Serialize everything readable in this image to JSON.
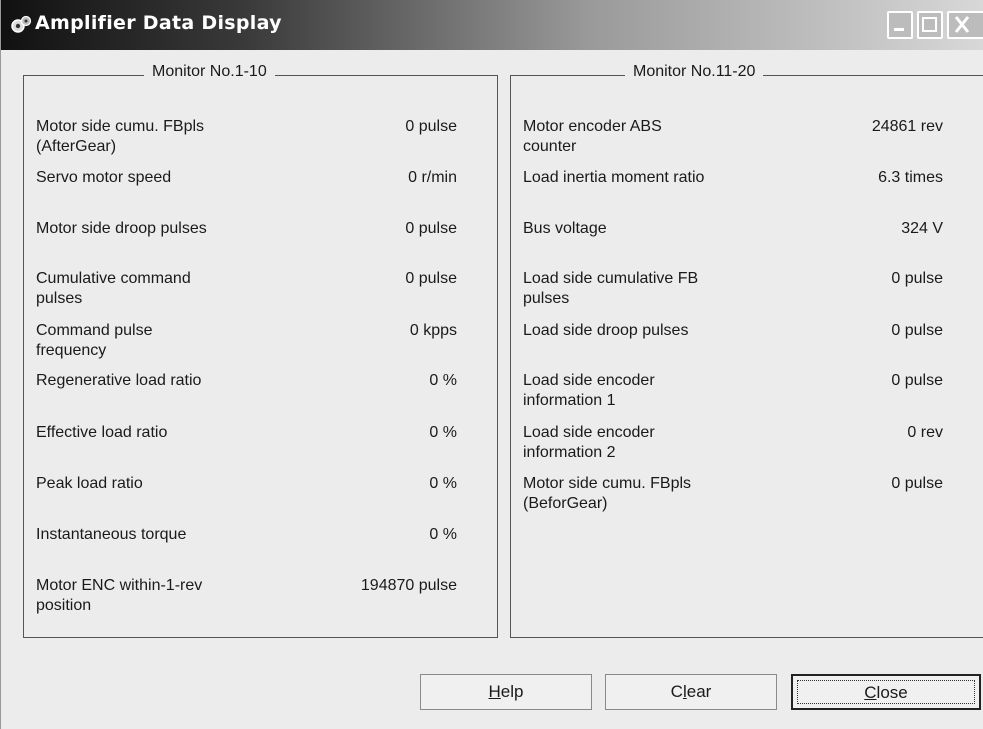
{
  "window": {
    "title": "Amplifier Data Display",
    "icons": {
      "app": "amplifier-gear-icon",
      "minimize": "minimize-icon",
      "maximize": "maximize-icon",
      "close": "close-icon"
    }
  },
  "groups": [
    {
      "title": "Monitor No.1-10",
      "items": [
        {
          "label": "Motor side cumu. FBpls\n(AfterGear)",
          "value": "0 pulse"
        },
        {
          "label": "Servo motor speed",
          "value": "0 r/min"
        },
        {
          "label": "Motor side droop pulses",
          "value": "0 pulse"
        },
        {
          "label": "Cumulative command\npulses",
          "value": "0 pulse"
        },
        {
          "label": "Command pulse\nfrequency",
          "value": "0 kpps"
        },
        {
          "label": "Regenerative load ratio",
          "value": "0 %"
        },
        {
          "label": "Effective load ratio",
          "value": "0 %"
        },
        {
          "label": "Peak load ratio",
          "value": "0 %"
        },
        {
          "label": "Instantaneous torque",
          "value": "0 %"
        },
        {
          "label": "Motor ENC within-1-rev\nposition",
          "value": "194870 pulse"
        }
      ]
    },
    {
      "title": "Monitor No.11-20",
      "items": [
        {
          "label": "Motor encoder ABS\ncounter",
          "value": "24861 rev"
        },
        {
          "label": "Load inertia moment ratio",
          "value": "6.3 times"
        },
        {
          "label": "Bus voltage",
          "value": "324 V"
        },
        {
          "label": "Load side cumulative FB\npulses",
          "value": "0 pulse"
        },
        {
          "label": "Load side droop pulses",
          "value": "0 pulse"
        },
        {
          "label": "Load side encoder\ninformation 1",
          "value": "0 pulse"
        },
        {
          "label": "Load side encoder\ninformation 2",
          "value": "0 rev"
        },
        {
          "label": "Motor side cumu. FBpls\n(BeforGear)",
          "value": "0 pulse"
        }
      ]
    }
  ],
  "buttons": {
    "help": {
      "accel": "H",
      "rest": "elp"
    },
    "clear": {
      "pre": "C",
      "accel": "l",
      "rest": "ear"
    },
    "close": {
      "accel": "C",
      "rest": "lose"
    }
  }
}
